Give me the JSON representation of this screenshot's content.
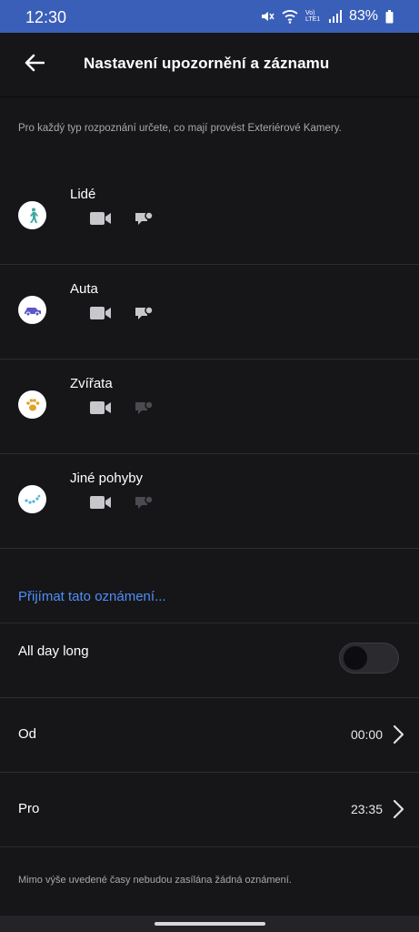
{
  "status": {
    "time": "12:30",
    "lte": "Vo) LTE1",
    "battery": "83%"
  },
  "header": {
    "title": "Nastavení upozornění a záznamu"
  },
  "intro": "Pro každý typ rozpoznání určete, co mají provést Exteriérové Kamery.",
  "categories": [
    {
      "label": "Lidé",
      "icon": "person-walking-icon",
      "video_enabled": true,
      "notify_enabled": true
    },
    {
      "label": "Auta",
      "icon": "car-icon",
      "video_enabled": true,
      "notify_enabled": true
    },
    {
      "label": "Zvířata",
      "icon": "paw-icon",
      "video_enabled": true,
      "notify_enabled": false
    },
    {
      "label": "Jiné pohyby",
      "icon": "motion-dots-icon",
      "video_enabled": true,
      "notify_enabled": false
    }
  ],
  "receive_link": "Přijímat tato oznámení...",
  "all_day": {
    "label": "All day long",
    "on": false
  },
  "from": {
    "label": "Od",
    "value": "00:00"
  },
  "to": {
    "label": "Pro",
    "value": "23:35"
  },
  "footer": "Mimo výše uvedené časy nebudou zasílána žádná oznámení.",
  "colors": {
    "status_bar": "#3a5fb8",
    "background": "#161619",
    "link": "#4f8ff7",
    "muted_text": "#a7a7ae"
  }
}
